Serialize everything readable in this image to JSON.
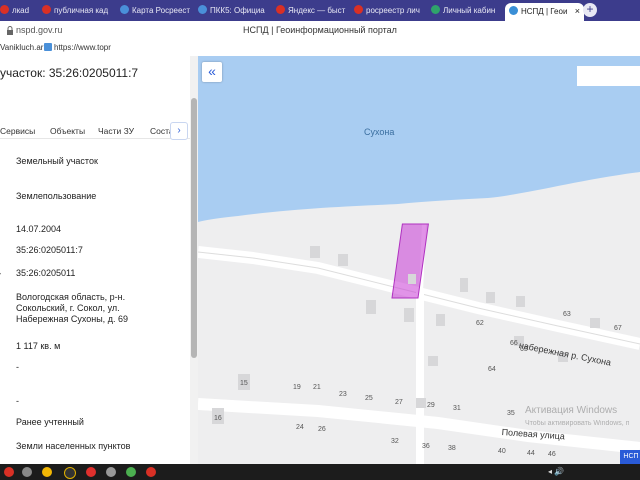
{
  "browser": {
    "tabs": [
      {
        "label": "Tanikluch...",
        "fav": "#d93025",
        "text": "лкad"
      },
      {
        "label": "публичная кад",
        "fav": "#d93025"
      },
      {
        "label": "Карта Росреест",
        "fav": "#4a90d9"
      },
      {
        "label": "ПКК5: Официа",
        "fav": "#4a90d9"
      },
      {
        "label": "Яндекс — быст",
        "fav": "#d93025"
      },
      {
        "label": "росреестр лич",
        "fav": "#d93025"
      },
      {
        "label": "Личный кабин",
        "fav": "#2fa36b"
      },
      {
        "label": "НСПД | Геои",
        "fav": "#3a8fd6",
        "active": true
      }
    ],
    "new_tab": "+",
    "close": "×",
    "url": "nspd.gov.ru",
    "page_title": "НСПД | Геоинформационный портал",
    "bookmarks": [
      {
        "label": "Vanikluch.ar"
      },
      {
        "label": "https://www.topr"
      }
    ]
  },
  "panel": {
    "title": "участок: 35:26:0205011:7",
    "tabs": [
      "Сервисы",
      "Объекты",
      "Части ЗУ",
      "Состав"
    ],
    "tab_arrow": "›",
    "fields": [
      "Земельный участок",
      "Землепользование",
      "14.07.2004",
      "35:26:0205011:7",
      "35:26:0205011",
      "Вологодская область, р-н. Сокольский, г. Сокол, ул. Набережная Сухоны, д. 69",
      "1 117 кв. м",
      "-",
      "-",
      "Ранее учтенный",
      "Земли населенных пунктов"
    ],
    "left_marker": "›"
  },
  "map": {
    "collapse_icon": "«",
    "river_label": "Сухона",
    "street_1": "набережная р. Сухона",
    "street_2": "Полевая улица",
    "house_numbers": [
      "62",
      "63",
      "67",
      "66",
      "65",
      "64",
      "15",
      "19",
      "21",
      "23",
      "25",
      "27",
      "29",
      "31",
      "35",
      "16",
      "24",
      "26",
      "32",
      "36",
      "38",
      "40",
      "44",
      "46"
    ],
    "watermark_title": "Активация Windows",
    "watermark_sub": "Чтобы активировать Windows, перейдите",
    "corner_badge": "НСП",
    "colors": {
      "water": "#a9cdf2",
      "land": "#eeeeef",
      "parcel": "#c93bd6"
    }
  },
  "taskbar": {
    "tray": "◂ 🔊"
  }
}
